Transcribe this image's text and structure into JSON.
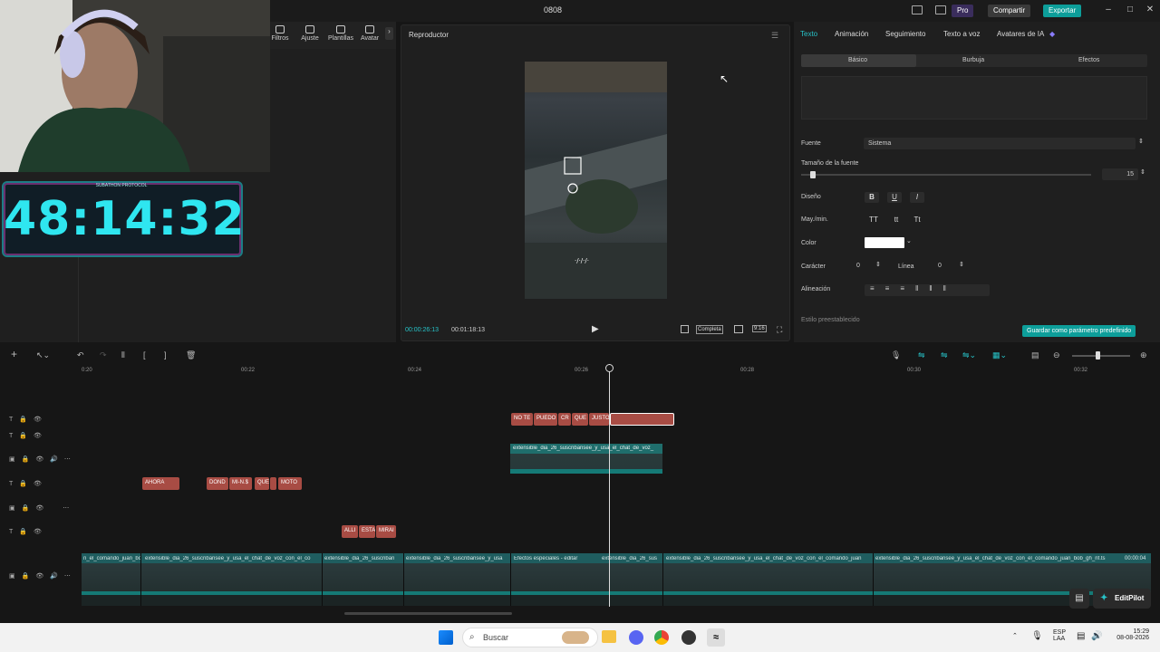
{
  "titlebar": {
    "title": "0808",
    "pro_label": "Pro",
    "share_label": "Compartir",
    "export_label": "Exportar"
  },
  "tools": [
    {
      "label": "Filtros"
    },
    {
      "label": "Ajuste"
    },
    {
      "label": "Plantillas"
    },
    {
      "label": "Avatar"
    }
  ],
  "overlay": {
    "timer": "48:14:32",
    "subathon_label": "SUBATHON PROTOCOL"
  },
  "player": {
    "title": "Reproductor",
    "current_time": "00:00:26:13",
    "total_time": "00:01:18:13",
    "complete_label": "Completa",
    "ratio_label": "9:16"
  },
  "right_panel": {
    "tabs": [
      "Texto",
      "Animación",
      "Seguimiento",
      "Texto a voz",
      "Avatares de IA"
    ],
    "subtabs": [
      "Básico",
      "Burbuja",
      "Efectos"
    ],
    "font_label": "Fuente",
    "font_value": "Sistema",
    "size_label": "Tamaño de la fuente",
    "size_value": "15",
    "size_level": 0.03,
    "design_label": "Diseño",
    "design_buttons": [
      "B",
      "U",
      "I"
    ],
    "case_label": "May./min.",
    "case_buttons": [
      "TT",
      "tt",
      "Tt"
    ],
    "color_label": "Color",
    "color_value": "#ffffff",
    "char_label": "Carácter",
    "char_value": "0",
    "line_label": "Línea",
    "line_value": "0",
    "align_label": "Alineación",
    "preset_label": "Estilo preestablecido",
    "save_label": "Guardar como parámetro predefinido"
  },
  "timeline": {
    "ticks": [
      "0:20",
      "00:22",
      "00:24",
      "00:26",
      "00:28",
      "00:30",
      "00:32"
    ],
    "text_clips_row1": [
      "NO TE",
      "PUEDO",
      "CR",
      "QUE",
      "JUSTO",
      ""
    ],
    "video_clip_label": "extensible_dia_26_suscribansee_y_usa_el_chat_de_voz_",
    "text_clips_row3": [
      "AHORA",
      "DOND",
      "MI-N.$",
      "QUE",
      "",
      "MOTO"
    ],
    "text_clips_row5": [
      "ALLI",
      "ESTA",
      "MIRAI"
    ],
    "main_labels": [
      "n_el_comando_juan_bo",
      "extensible_dia_26_suscribansee_y_usa_el_chat_de_voz_con_el_co",
      "extensible_dia_26_suscriban",
      "extensible_dia_26_suscribansee_y_usa",
      "Efectos especiales - editar",
      "extensible_dia_26_sus",
      "extensible_dia_26_suscribansee_y_usa_el_chat_de_voz_con_el_comando_juan",
      "extensible_dia_26_suscribansee_y_usa_el_chat_de_voz_con_el_comando_juan_bob_gh_nf.ts",
      "00:00:04"
    ],
    "editpilot_label": "EditPilot"
  },
  "taskbar": {
    "search_placeholder": "Buscar",
    "lang": "ESP",
    "lang2": "LAA",
    "time": "15:29",
    "date": "08-08-2026"
  },
  "colors": {
    "accent": "#0d9e9a",
    "clip": "#a84c44",
    "timer": "#2fe6f0"
  }
}
